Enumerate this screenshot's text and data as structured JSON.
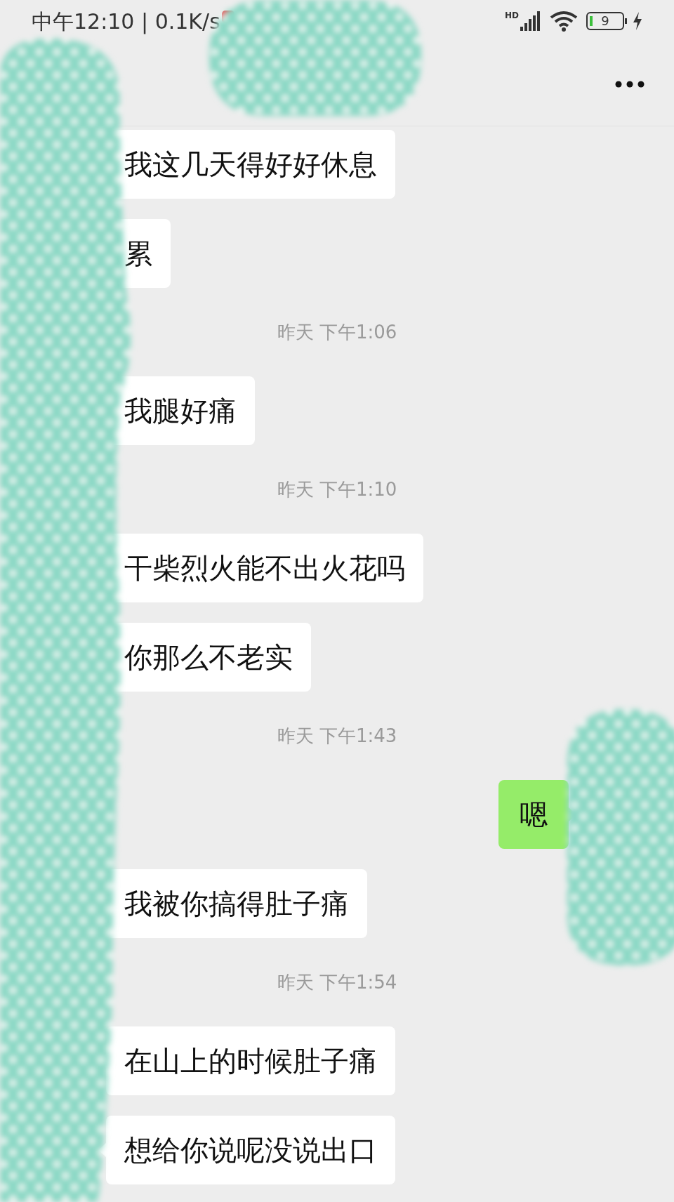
{
  "status_bar": {
    "text": "中午12:10 | 0.1K/s",
    "network_label": "HD",
    "battery": "9"
  },
  "messages": [
    {
      "kind": "received",
      "text": "我这几天得好好休息"
    },
    {
      "kind": "received",
      "text": "累"
    },
    {
      "kind": "time",
      "text": "昨天 下午1:06"
    },
    {
      "kind": "received",
      "text": "我腿好痛"
    },
    {
      "kind": "time",
      "text": "昨天 下午1:10"
    },
    {
      "kind": "received",
      "text": "干柴烈火能不出火花吗"
    },
    {
      "kind": "received",
      "text": "你那么不老实"
    },
    {
      "kind": "time",
      "text": "昨天 下午1:43"
    },
    {
      "kind": "sent",
      "text": "嗯"
    },
    {
      "kind": "received",
      "text": "我被你搞得肚子痛"
    },
    {
      "kind": "time",
      "text": "昨天 下午1:54"
    },
    {
      "kind": "received",
      "text": "在山上的时候肚子痛"
    },
    {
      "kind": "received",
      "text": "想给你说呢没说出口"
    }
  ]
}
